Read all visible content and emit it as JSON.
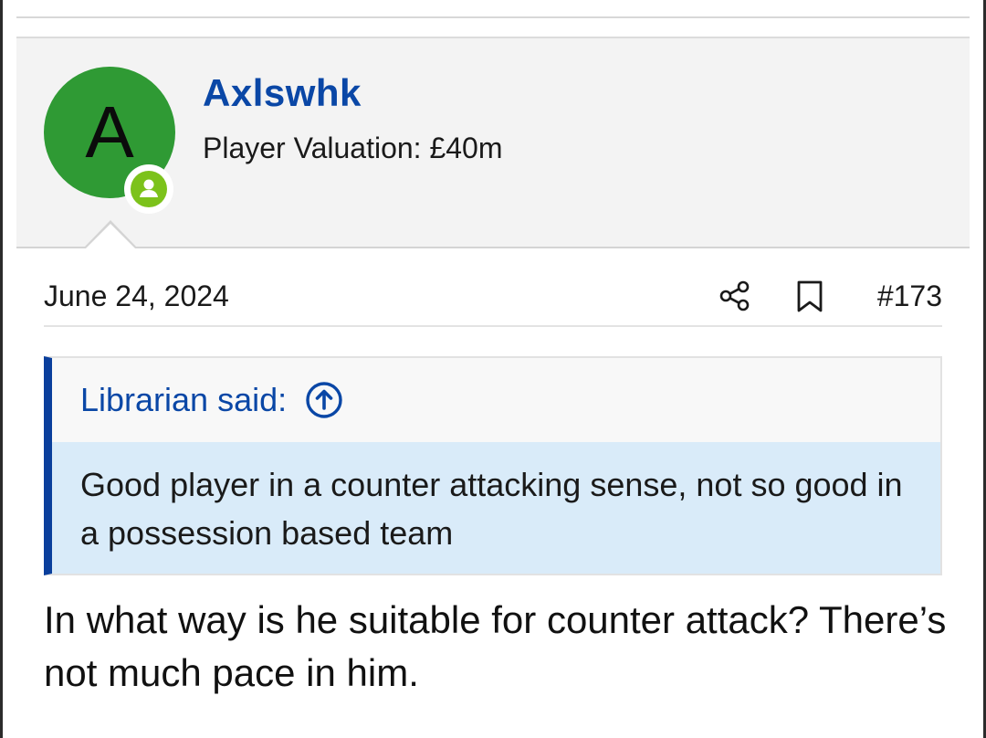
{
  "user": {
    "avatar_letter": "A",
    "avatar_color": "#2f9a34",
    "online_badge_color": "#7cc21b",
    "online_icon": "user-icon",
    "username": "Axlswhk",
    "title": "Player Valuation: £40m",
    "username_color": "#0a47a6"
  },
  "post": {
    "date": "June 24, 2024",
    "share_icon": "share-icon",
    "bookmark_icon": "bookmark-icon",
    "number": "#173",
    "body": "In what way is he suitable for counter attack? There’s not much pace in him."
  },
  "quote": {
    "author": "Librarian said:",
    "jump_icon": "arrow-up-circle-icon",
    "text": "Good player in a counter attacking sense, not so good in a possession based team",
    "accent_color": "#0a3f9c",
    "background_color": "#d9ebf9"
  }
}
